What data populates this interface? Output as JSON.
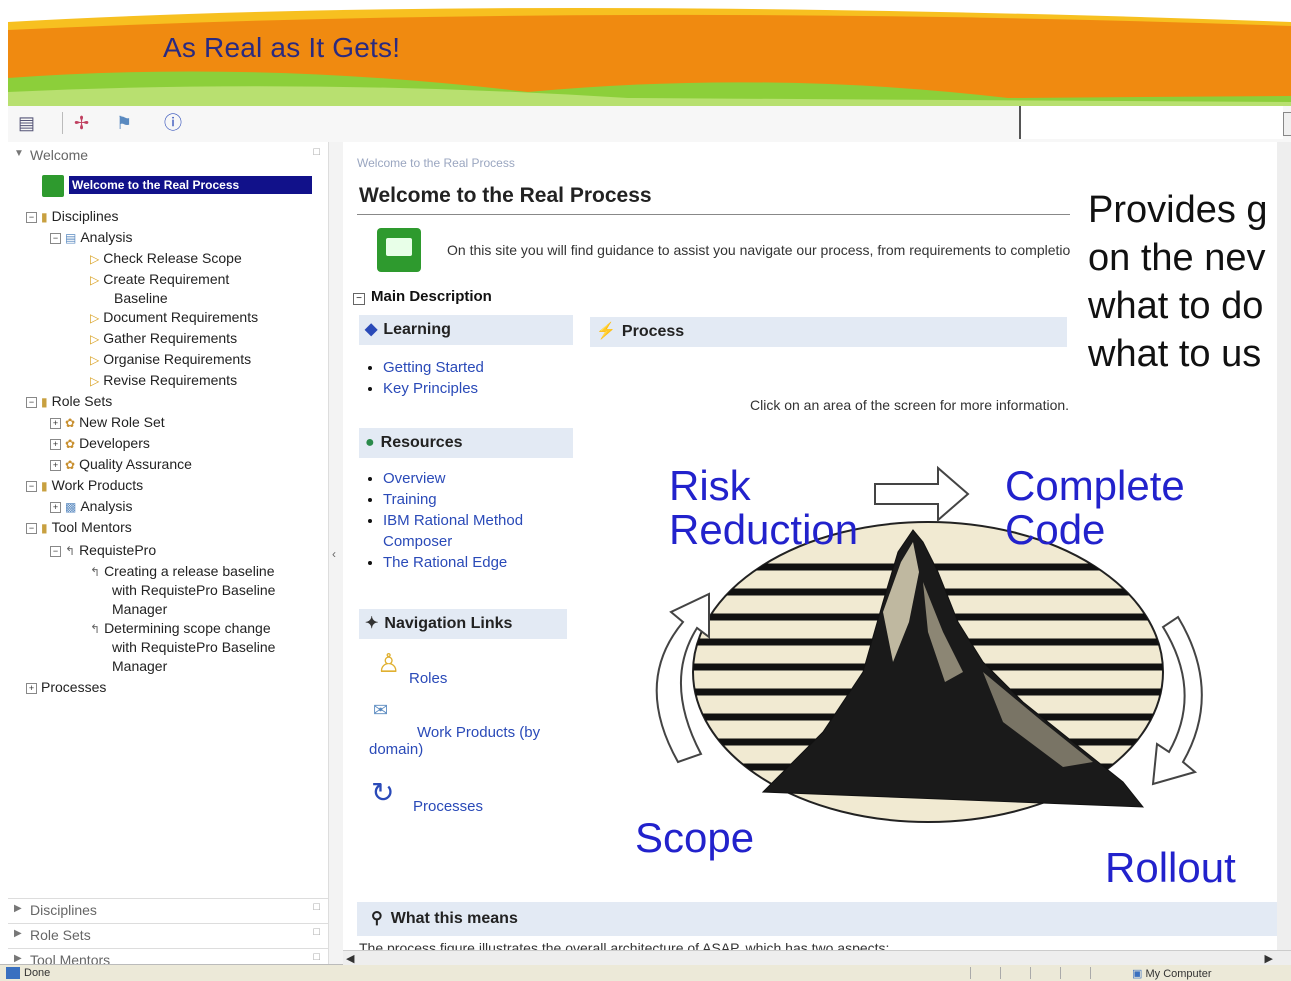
{
  "banner": {
    "title": "As Real as It Gets!"
  },
  "toolbar": {
    "icons": [
      "view-icon",
      "tree-icon",
      "glossary-icon",
      "about-icon"
    ]
  },
  "tree": {
    "header": "Welcome",
    "selected": "Welcome to the Real Process",
    "nodes": {
      "disciplines": "Disciplines",
      "analysis": "Analysis",
      "check_scope": "Check Release Scope",
      "create_req_1": "Create Requirement",
      "create_req_2": "Baseline",
      "document_req": "Document Requirements",
      "gather_req": "Gather Requirements",
      "organise_req": "Organise Requirements",
      "revise_req": "Revise Requirements",
      "role_sets": "Role Sets",
      "new_role_set": "New Role Set",
      "developers": "Developers",
      "qa": "Quality Assurance",
      "work_products": "Work Products",
      "wp_analysis": "Analysis",
      "tool_mentors": "Tool Mentors",
      "requistepro": "RequistePro",
      "creating_1": "Creating a release baseline",
      "creating_2": "with RequistePro Baseline",
      "creating_3": "Manager",
      "determining_1": "Determining scope change",
      "determining_2": "with RequistePro Baseline",
      "determining_3": "Manager",
      "processes": "Processes"
    },
    "bottom_headers": [
      "Disciplines",
      "Role Sets",
      "Tool Mentors"
    ]
  },
  "content": {
    "breadcrumb": "Welcome to the Real Process",
    "title": "Welcome to the Real Process",
    "intro": "On this site you will find guidance to assist you navigate our process, from requirements to completion.",
    "main_description": "Main Description",
    "learning": {
      "title": "Learning",
      "links": [
        "Getting Started",
        "Key Principles"
      ]
    },
    "resources": {
      "title": "Resources",
      "links": [
        "Overview",
        "Training",
        "IBM Rational Method Composer",
        "The Rational Edge"
      ]
    },
    "navigation": {
      "title": "Navigation Links",
      "roles": "Roles",
      "work_products": "Work Products (by domain)",
      "processes": "Processes"
    },
    "process": {
      "title": "Process",
      "click_info": "Click on an area of the screen for more information."
    },
    "diagram": {
      "risk_1": "Risk",
      "risk_2": "Reduction",
      "complete_1": "Complete",
      "complete_2": "Code",
      "scope": "Scope",
      "rollout": "Rollout"
    },
    "what_this_means": "What this means",
    "what_text": "The process figure illustrates the overall architecture of ASAP, which has two aspects:"
  },
  "overlay": {
    "lines": [
      "Provides g",
      "on the nev",
      "what to do",
      "what to us"
    ]
  },
  "status": {
    "text": "Done",
    "zone": "My Computer"
  },
  "colors": {
    "selection": "#11118a",
    "link": "#2a4ab8",
    "diagram_text": "#2222cc",
    "banner_orange": "#f08a10"
  }
}
